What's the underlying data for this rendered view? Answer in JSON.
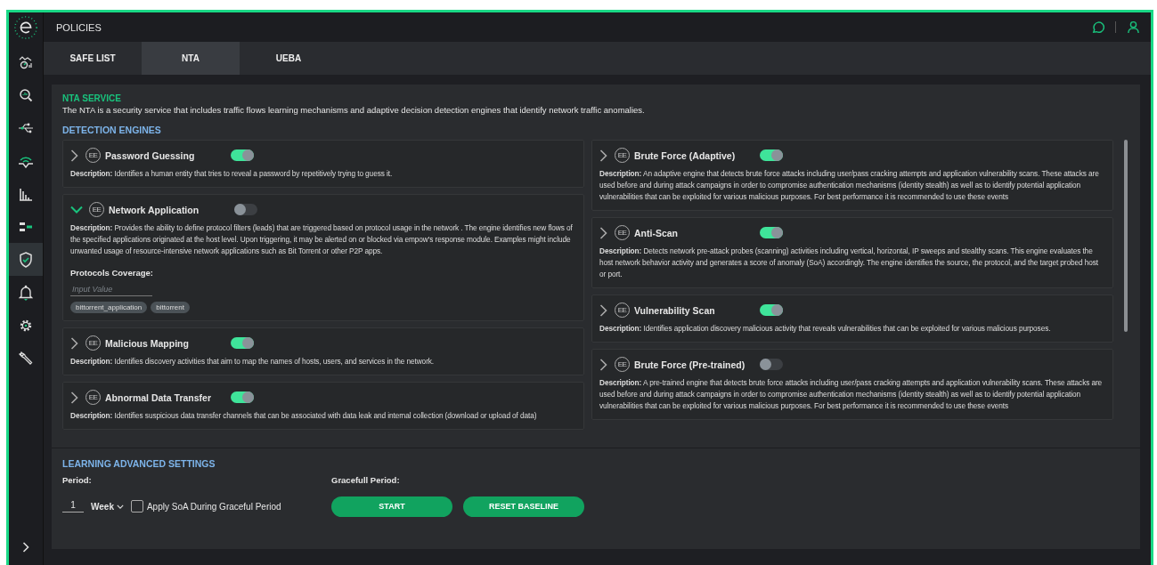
{
  "header": {
    "title": "POLICIES"
  },
  "sidebar": {
    "items": [
      {
        "selected": false
      },
      {
        "selected": false
      },
      {
        "selected": false
      },
      {
        "selected": false
      },
      {
        "selected": false
      },
      {
        "selected": false
      },
      {
        "selected": true
      },
      {
        "selected": false
      },
      {
        "selected": false
      },
      {
        "selected": false
      }
    ]
  },
  "tabs": [
    {
      "label": "SAFE LIST",
      "selected": false
    },
    {
      "label": "NTA",
      "selected": true
    },
    {
      "label": "UEBA",
      "selected": false
    }
  ],
  "service": {
    "title": "NTA SERVICE",
    "text": "The NTA is a security service that includes traffic flows learning mechanisms and adaptive decision detection engines that identify network traffic anomalies."
  },
  "engines": {
    "title": "DETECTION ENGINES",
    "columns": [
      [
        {
          "badge": "EE",
          "name": "Password Guessing",
          "enabled": true,
          "expanded": false,
          "description": "**Description:** Identifies a human entity that tries to reveal a password by repetitively trying to guess it."
        },
        {
          "badge": "EE",
          "name": "Network Application",
          "enabled": false,
          "expanded": true,
          "description": "**Description:** Provides the ability to define protocol filters (leads) that are triggered based on protocol usage in the network . The engine identifies new flows of the specified applications originated at the host level. Upon triggering, it may be alerted on or blocked via empow's response module. Examples might include unwanted usage of resource-intensive network applications such as Bit Torrent or other P2P apps.",
          "protocols": {
            "label": "Protocols Coverage:",
            "placeholder": "Input Value",
            "tags": [
              "bittorrent_application",
              "bittorrent"
            ]
          }
        },
        {
          "badge": "EE",
          "name": "Malicious Mapping",
          "enabled": true,
          "expanded": false,
          "description": "**Description:** Identifies discovery activities that aim to map the names of hosts, users, and services in the network."
        },
        {
          "badge": "EE",
          "name": "Abnormal Data Transfer",
          "enabled": true,
          "expanded": false,
          "description": "**Description:** Identifies suspicious data transfer channels that can be associated with data leak and internal collection (download or upload of data)"
        }
      ],
      [
        {
          "badge": "EE",
          "name": "Brute Force (Adaptive)",
          "enabled": true,
          "expanded": false,
          "description": "**Description:** An adaptive engine that detects brute force attacks including user/pass cracking attempts and application vulnerability scans. These attacks are used before and during attack campaigns in order to compromise authentication mechanisms (identity stealth) as well as to identify potential application vulnerabilities that can be exploited for various malicious purposes. For best performance it is recommended to use these events"
        },
        {
          "badge": "EE",
          "name": "Anti-Scan",
          "enabled": true,
          "expanded": false,
          "description": "**Description:** Detects network pre-attack probes (scanning) activities including vertical, horizontal, IP sweeps and stealthy scans. This engine evaluates the host network behavior activity and generates a score of anomaly (SoA) accordingly. The engine identifies the source, the protocol, and the target probed host or port."
        },
        {
          "badge": "EE",
          "name": "Vulnerability Scan",
          "enabled": true,
          "expanded": false,
          "description": "**Description:** Identifies application discovery malicious activity that reveals vulnerabilities that can be exploited for various malicious purposes."
        },
        {
          "badge": "EE",
          "name": "Brute Force (Pre-trained)",
          "enabled": false,
          "expanded": false,
          "description": "**Description:** A pre-trained engine that detects brute force attacks including user/pass cracking attempts and application vulnerability scans. These attacks are used before and during attack campaigns in order to compromise authentication mechanisms (identity stealth) as well as to identify potential application vulnerabilities that can be exploited for various malicious purposes. For best performance it is recommended to use these events"
        }
      ]
    ]
  },
  "learning": {
    "title": "LEARNING ADVANCED SETTINGS",
    "period_label": "Period:",
    "period_value": "1",
    "period_unit": "Week",
    "apply": {
      "label": "Apply SoA During Graceful Period",
      "checked": false
    },
    "graceful_label": "Gracefull Period:",
    "buttons": [
      "START",
      "RESET BASELINE"
    ]
  }
}
